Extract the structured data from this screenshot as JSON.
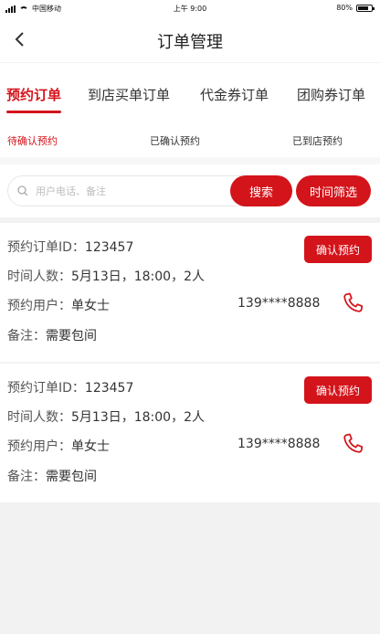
{
  "status_bar": {
    "carrier": "中国移动",
    "time": "上午 9:00",
    "battery": "80%",
    "battery_level": 0.8
  },
  "nav": {
    "title": "订单管理"
  },
  "tabs": [
    {
      "label": "预约订单",
      "active": true
    },
    {
      "label": "到店买单订单",
      "active": false
    },
    {
      "label": "代金券订单",
      "active": false
    },
    {
      "label": "团购券订单",
      "active": false
    }
  ],
  "subtabs": [
    {
      "label": "待确认预约",
      "active": true
    },
    {
      "label": "已确认预约",
      "active": false
    },
    {
      "label": "已到店预约",
      "active": false
    }
  ],
  "search": {
    "placeholder": "用户电话、备注",
    "search_label": "搜索",
    "time_filter_label": "时间筛选"
  },
  "orders": [
    {
      "id_label": "预约订单ID：",
      "id": "123457",
      "time_label": "时间人数：",
      "time_value": "5月13日，18:00，2人",
      "user_label": "预约用户：",
      "user_name": "单女士",
      "phone": "139****8888",
      "note_label": "备注：",
      "note": "需要包间",
      "confirm_label": "确认预约"
    },
    {
      "id_label": "预约订单ID：",
      "id": "123457",
      "time_label": "时间人数：",
      "time_value": "5月13日，18:00，2人",
      "user_label": "预约用户：",
      "user_name": "单女士",
      "phone": "139****8888",
      "note_label": "备注：",
      "note": "需要包间",
      "confirm_label": "确认预约"
    }
  ],
  "colors": {
    "accent": "#d3141b",
    "background": "#f2f2f2"
  }
}
